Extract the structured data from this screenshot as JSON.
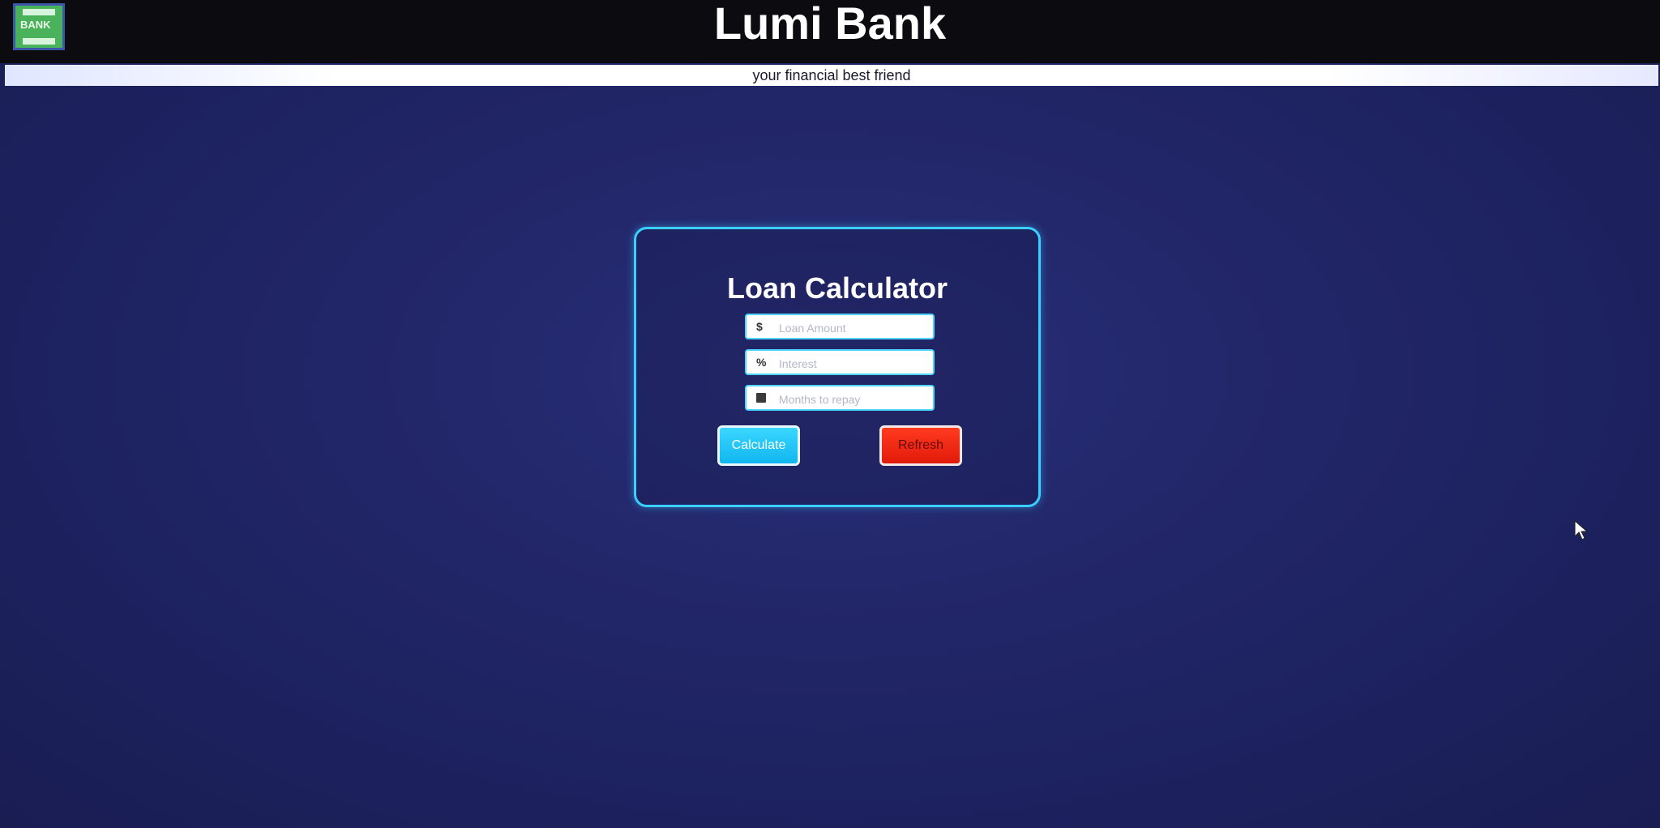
{
  "header": {
    "logo_text": "BANK",
    "title": "Lumi Bank",
    "tagline": "your financial best friend"
  },
  "calculator": {
    "title": "Loan Calculator",
    "fields": [
      {
        "icon": "dollar-icon",
        "icon_glyph": "$",
        "placeholder": "Loan Amount",
        "value": ""
      },
      {
        "icon": "percent-icon",
        "icon_glyph": "%",
        "placeholder": "Interest",
        "value": ""
      },
      {
        "icon": "calendar-icon",
        "icon_glyph": "",
        "placeholder": "Months to repay",
        "value": ""
      }
    ],
    "buttons": {
      "calculate": "Calculate",
      "refresh": "Refresh"
    }
  },
  "colors": {
    "accent": "#39d0ff",
    "calculate_button": "#10b6ef",
    "refresh_button": "#e01a0a",
    "logo_green": "#4bb25c",
    "background": "#22276a"
  }
}
